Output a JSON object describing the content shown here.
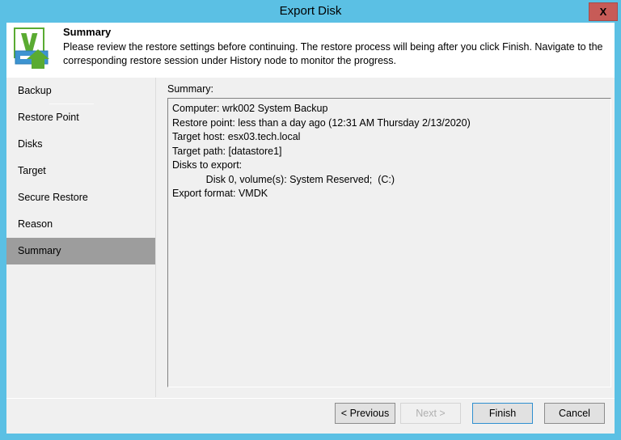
{
  "window": {
    "title": "Export Disk",
    "close_label": "X",
    "accent_color": "#5bc0e4",
    "close_color": "#c75b57"
  },
  "header": {
    "icon": "veeam-export-icon",
    "title": "Summary",
    "description": "Please review the restore settings before continuing. The restore process will being after you click Finish. Navigate to the corresponding restore session under History node to monitor the progress."
  },
  "sidebar": {
    "items": [
      {
        "label": "Backup",
        "selected": false,
        "rule_below": true
      },
      {
        "label": "Restore Point",
        "selected": false,
        "rule_below": false
      },
      {
        "label": "Disks",
        "selected": false,
        "rule_below": false
      },
      {
        "label": "Target",
        "selected": false,
        "rule_below": false
      },
      {
        "label": "Secure Restore",
        "selected": false,
        "rule_below": false
      },
      {
        "label": "Reason",
        "selected": false,
        "rule_below": false
      },
      {
        "label": "Summary",
        "selected": true,
        "rule_below": false
      }
    ]
  },
  "main": {
    "summary_label": "Summary:",
    "summary_lines": [
      "Computer: wrk002 System Backup",
      "Restore point: less than a day ago (12:31 AM Thursday 2/13/2020)",
      "Target host: esx03.tech.local",
      "Target path: [datastore1]",
      "Disks to export:",
      "            Disk 0, volume(s): System Reserved;  (C:)",
      "Export format: VMDK"
    ],
    "summary_text": "Computer: wrk002 System Backup\nRestore point: less than a day ago (12:31 AM Thursday 2/13/2020)\nTarget host: esx03.tech.local\nTarget path: [datastore1]\nDisks to export:\n            Disk 0, volume(s): System Reserved;  (C:)\nExport format: VMDK"
  },
  "footer": {
    "previous_label": "< Previous",
    "next_label": "Next >",
    "next_disabled": true,
    "finish_label": "Finish",
    "finish_is_default": true,
    "cancel_label": "Cancel"
  }
}
